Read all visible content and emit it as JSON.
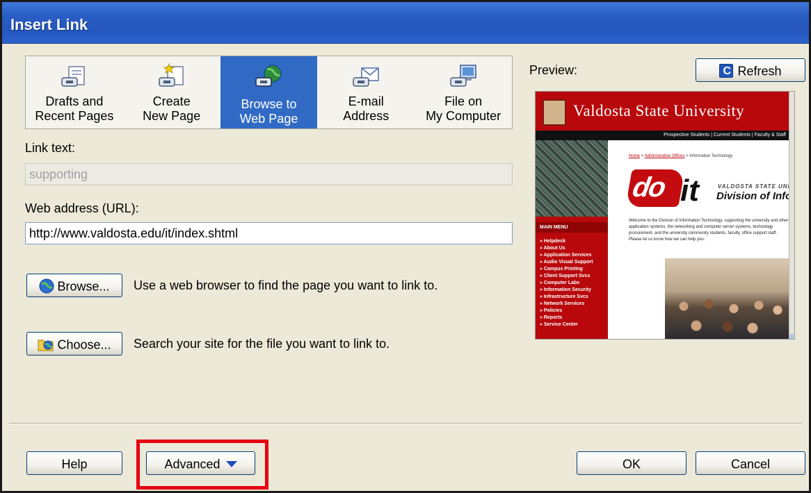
{
  "window": {
    "title": "Insert Link"
  },
  "link_types": [
    {
      "label": "Drafts and\nRecent Pages",
      "icon": "drafts-link-icon",
      "selected": false
    },
    {
      "label": "Create\nNew Page",
      "icon": "new-page-link-icon",
      "selected": false
    },
    {
      "label": "Browse to\nWeb Page",
      "icon": "web-globe-link-icon",
      "selected": true
    },
    {
      "label": "E-mail\nAddress",
      "icon": "email-link-icon",
      "selected": false
    },
    {
      "label": "File on\nMy Computer",
      "icon": "computer-link-icon",
      "selected": false
    }
  ],
  "link_text": {
    "label": "Link text:",
    "value": "supporting"
  },
  "url": {
    "label": "Web address (URL):",
    "value": "http://www.valdosta.edu/it/index.shtml"
  },
  "browse": {
    "label": "Browse...",
    "description": "Use a web browser to find the page you want to link to.",
    "icon": "globe-icon"
  },
  "choose": {
    "label": "Choose...",
    "description": "Search your site for the file you want to link to.",
    "icon": "folder-icon"
  },
  "preview": {
    "label": "Preview:",
    "refresh_label": "Refresh",
    "site_title": "Valdosta State University",
    "nav_links": "Prospective Students | Current Students | Faculty & Staff",
    "breadcrumb": {
      "home": "Home",
      "sep1": " > ",
      "section": "Administrative Offices",
      "sep2": " > ",
      "current": "Information Technology"
    },
    "logo_text": "do",
    "logo_it": "it",
    "logo_small": "VALDOSTA STATE UNIV",
    "logo_division": "Division of Infor",
    "welcome_text": "Welcome to the Division of Information Technology, supporting the university and other application systems, the networking and computer server systems, technology procurement, and the university community students, faculty, office support staff. Please let us know how we can help you.",
    "menu_header": "MAIN MENU",
    "menu_items": [
      "Helpdesk",
      "About Us",
      "Application Services",
      "Audio Visual Support",
      "Campus Printing",
      "Client Support Svcs",
      "Computer Labs",
      "Information Security",
      "Infrastructure Svcs",
      "Network Services",
      "Policies",
      "Reports",
      "Service Center"
    ]
  },
  "footer": {
    "help_label": "Help",
    "advanced_label": "Advanced",
    "ok_label": "OK",
    "cancel_label": "Cancel"
  }
}
